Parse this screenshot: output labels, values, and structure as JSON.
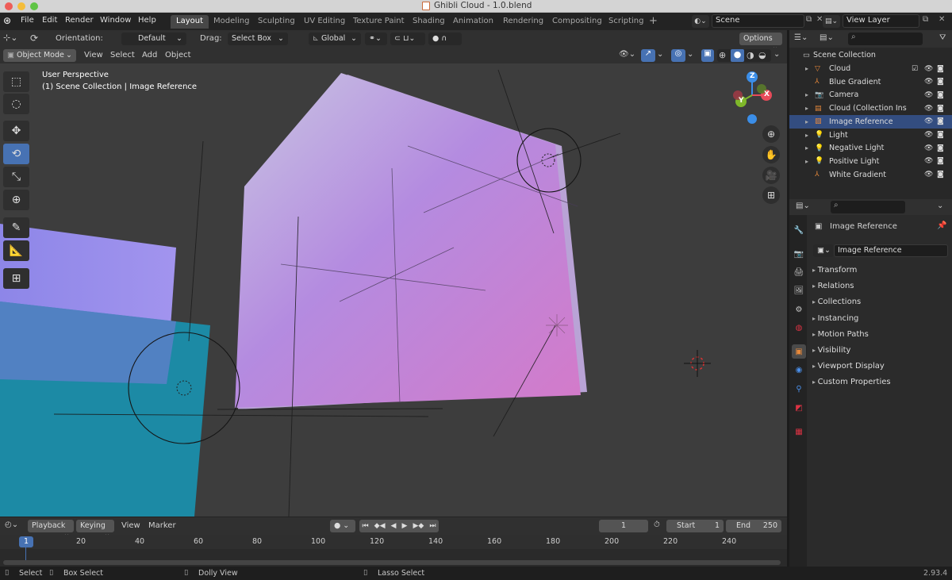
{
  "window": {
    "title": "Ghibli Cloud - 1.0.blend"
  },
  "menus": [
    "File",
    "Edit",
    "Render",
    "Window",
    "Help"
  ],
  "workspaces": [
    "Layout",
    "Modeling",
    "Sculpting",
    "UV Editing",
    "Texture Paint",
    "Shading",
    "Animation",
    "Rendering",
    "Compositing",
    "Scripting"
  ],
  "active_workspace": "Layout",
  "scene": {
    "name": "Scene",
    "view_layer": "View Layer"
  },
  "header": {
    "orientation_label": "Orientation:",
    "orientation_value": "Default",
    "drag_label": "Drag:",
    "drag_value": "Select Box",
    "transform_orientation": "Global",
    "options_label": "Options"
  },
  "viewport_header": {
    "mode": "Object Mode",
    "menu": [
      "View",
      "Select",
      "Add",
      "Object"
    ]
  },
  "viewport": {
    "overlay_line1": "User Perspective",
    "overlay_line2": "(1) Scene Collection | Image Reference"
  },
  "gizmo": {
    "z_label": "Z",
    "y_label": "Y",
    "x_label": "X"
  },
  "colors": {
    "accent": "#4772b3",
    "gizmo_x": "#e84b5a",
    "gizmo_y": "#7fb82a",
    "gizmo_z": "#3b8ee8",
    "object_orange": "#e8893a"
  },
  "outliner": {
    "root": "Scene Collection",
    "items": [
      {
        "label": "Cloud",
        "icon": "mesh-triangle-icon"
      },
      {
        "label": "Blue Gradient",
        "icon": "empty-icon"
      },
      {
        "label": "Camera",
        "icon": "camera-icon"
      },
      {
        "label": "Cloud (Collection Insta",
        "icon": "collection-instance-icon"
      },
      {
        "label": "Image Reference",
        "icon": "image-icon"
      },
      {
        "label": "Light",
        "icon": "light-icon"
      },
      {
        "label": "Negative Light",
        "icon": "light-icon"
      },
      {
        "label": "Positive Light",
        "icon": "light-icon"
      },
      {
        "label": "White Gradient",
        "icon": "empty-icon"
      }
    ]
  },
  "properties": {
    "object_name": "Image Reference",
    "object_field": "Image Reference",
    "panels": [
      "Transform",
      "Relations",
      "Collections",
      "Instancing",
      "Motion Paths",
      "Visibility",
      "Viewport Display",
      "Custom Properties"
    ]
  },
  "timeline": {
    "menu": [
      "Playback",
      "Keying",
      "View",
      "Marker"
    ],
    "current_frame": "1",
    "start_label": "Start",
    "start_value": "1",
    "end_label": "End",
    "end_value": "250",
    "ticks": [
      "20",
      "40",
      "60",
      "80",
      "100",
      "120",
      "140",
      "160",
      "180",
      "200",
      "220",
      "240"
    ],
    "playhead": "1"
  },
  "status": {
    "select": "Select",
    "box_select": "Box Select",
    "dolly_view": "Dolly View",
    "lasso_select": "Lasso Select",
    "version": "2.93.4"
  }
}
